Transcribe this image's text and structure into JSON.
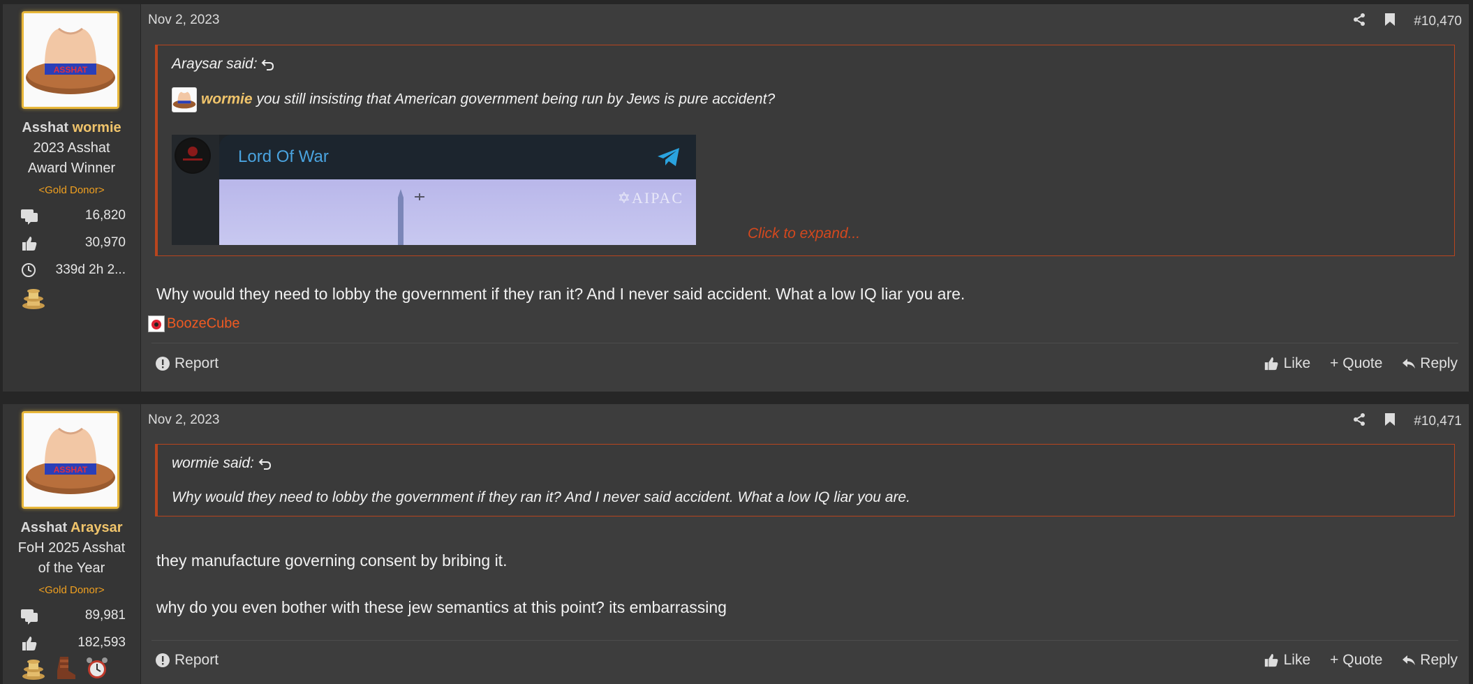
{
  "posts": [
    {
      "author_prefix": "Asshat",
      "author": "wormie",
      "user_title": [
        "2023 Asshat",
        "Award Winner"
      ],
      "donor": "<Gold Donor>",
      "stats": {
        "messages": "16,820",
        "reactions": "30,970",
        "time": "339d 2h 2..."
      },
      "date": "Nov 2, 2023",
      "post_number": "#10,470",
      "quote": {
        "author_line": "Araysar said:",
        "mention": "wormie",
        "text": " you still insisting that American government being run by Jews is pure accident?",
        "embed": {
          "channel": "Lord Of War",
          "image_text": "✡AIPAC"
        },
        "expand": "Click to expand..."
      },
      "body": [
        "Why would they need to lobby the government if they ran it? And I never said accident. What a low IQ liar you are."
      ],
      "reaction_user": "BoozeCube"
    },
    {
      "author_prefix": "Asshat",
      "author": "Araysar",
      "user_title": [
        "FoH 2025 Asshat",
        "of the Year"
      ],
      "donor": "<Gold Donor>",
      "stats": {
        "messages": "89,981",
        "reactions": "182,593"
      },
      "date": "Nov 2, 2023",
      "post_number": "#10,471",
      "quote": {
        "author_line": "wormie said:",
        "text": "Why would they need to lobby the government if they ran it? And I never said accident. What a low IQ liar you are."
      },
      "body": [
        "they manufacture governing consent by bribing it.",
        "why do you even bother with these jew semantics at this point? its embarrassing"
      ]
    }
  ],
  "actions": {
    "report": "Report",
    "like": "Like",
    "quote": "Quote",
    "reply": "Reply"
  },
  "colors": {
    "accent_gold": "#f0c46b",
    "quote_border": "#b8451e",
    "donor": "#f0a020",
    "link_orange": "#f05a22"
  }
}
